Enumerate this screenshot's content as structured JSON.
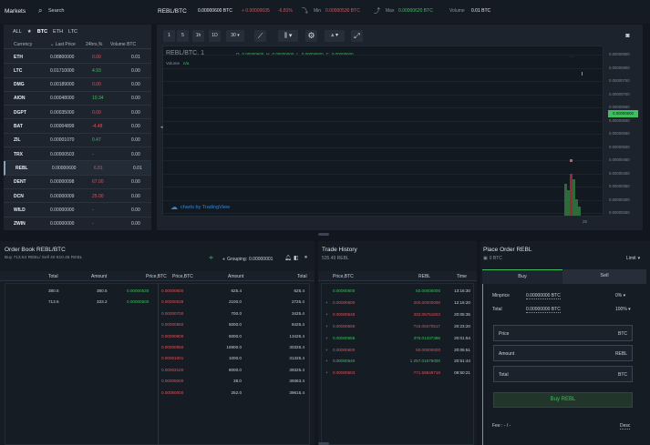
{
  "topbar": {
    "markets_label": "Markets",
    "search_label": "Search",
    "pair": "REBL/BTC",
    "last_price": "0.00000600 BTC",
    "change_abs": "+ 0.00000035",
    "change_pct": "-6.81%",
    "min_label": "Min",
    "min_value": "0.00000530 BTC",
    "max_label": "Max",
    "max_value": "0.00000620 BTC",
    "volume_label": "Volume",
    "volume_value": "0.01 BTC"
  },
  "markets": {
    "tabs": [
      "ALL",
      "★",
      "BTC",
      "ETH",
      "LTC"
    ],
    "active_tab": "BTC",
    "columns": [
      "Currency",
      "⌄ Last Price",
      "24hrs,%",
      "Volume BTC"
    ],
    "rows": [
      {
        "currency": "ETH",
        "price": "0.08800000",
        "change": "0.00",
        "dir": "red",
        "volume": "0.01"
      },
      {
        "currency": "LTC",
        "price": "0.01710000",
        "change": "4.93",
        "dir": "green",
        "volume": "0.00"
      },
      {
        "currency": "DMG",
        "price": "0.00189000",
        "change": "0.00",
        "dir": "red",
        "volume": "0.00"
      },
      {
        "currency": "AION",
        "price": "0.00048000",
        "change": "10.34",
        "dir": "green",
        "volume": "0.00"
      },
      {
        "currency": "DGPT",
        "price": "0.00035000",
        "change": "0.00",
        "dir": "red",
        "volume": "0.00"
      },
      {
        "currency": "BAT",
        "price": "0.00004899",
        "change": "-4.48",
        "dir": "red",
        "volume": "0.00"
      },
      {
        "currency": "ZIL",
        "price": "0.00001070",
        "change": "0.47",
        "dir": "green",
        "volume": "0.00"
      },
      {
        "currency": "TRX",
        "price": "0.00000503",
        "change": "-",
        "dir": "muted",
        "volume": "0.00"
      },
      {
        "currency": "REBL",
        "price": "0.00000600",
        "change": "6.81",
        "dir": "red",
        "volume": "0.01"
      },
      {
        "currency": "DENT",
        "price": "0.00000098",
        "change": "67.00",
        "dir": "red",
        "volume": "0.00"
      },
      {
        "currency": "DCN",
        "price": "0.00000009",
        "change": "25.00",
        "dir": "red",
        "volume": "0.00"
      },
      {
        "currency": "WILD",
        "price": "0.00000000",
        "change": "-",
        "dir": "muted",
        "volume": "0.00"
      },
      {
        "currency": "ZWIN",
        "price": "0.00000000",
        "change": "-",
        "dir": "muted",
        "volume": "0.00"
      }
    ]
  },
  "chart": {
    "intervals": [
      "1",
      "5",
      "1h",
      "1D",
      "30"
    ],
    "legend_symbol": "REBL/BTC, 1",
    "legend_o": "O",
    "legend_o_val": "0.00000600",
    "legend_h": "H",
    "legend_h_val": "0.00000600",
    "legend_l": "L",
    "legend_l_val": "0.00000600",
    "legend_c": "C",
    "legend_c_val": "0.00000600",
    "volume_label": "Volume",
    "volume_val": "n/a",
    "price_ticks": [
      "0.00000900",
      "0.00000800",
      "0.00000750",
      "0.00000700",
      "0.00000650",
      "0.00000600",
      "0.00000550",
      "0.00000500",
      "0.00000450",
      "0.00000400",
      "0.00000350",
      "0.00000300",
      "0.00000250"
    ],
    "current_price_tag": "0.00000600",
    "x_tick": "25",
    "watermark": "charts by TradingView",
    "colors": {
      "up": "#3fbf5f",
      "down": "#e0525a",
      "accent": "#3fbf5f"
    }
  },
  "orderbook": {
    "title": "Order Book REBL/BTC",
    "subtitle": "Buy 713.64 REBL/ Sell 40 610.45 REBL",
    "grouping_label": "Grouping:",
    "grouping_value": "0.00000001",
    "buy_columns": [
      "Total",
      "Amount",
      "Price,BTC"
    ],
    "sell_columns": [
      "Price,BTC",
      "Amount",
      "Total"
    ],
    "buys": [
      {
        "total": "380.5",
        "amount": "380.5",
        "price": "0.00000530"
      },
      {
        "total": "713.6",
        "amount": "333.2",
        "price": "0.00000500"
      }
    ],
    "sells": [
      {
        "price": "0.00000600",
        "amount": "625.4",
        "total": "625.4"
      },
      {
        "price": "0.00000639",
        "amount": "2100.0",
        "total": "2725.4"
      },
      {
        "price": "0.00000700",
        "amount": "700.0",
        "total": "3425.4"
      },
      {
        "price": "0.00000850",
        "amount": "5000.0",
        "total": "8425.4"
      },
      {
        "price": "0.00000900",
        "amount": "5000.0",
        "total": "13425.4"
      },
      {
        "price": "0.00000950",
        "amount": "16900.0",
        "total": "30325.4"
      },
      {
        "price": "0.00001001",
        "amount": "1000.0",
        "total": "31325.4"
      },
      {
        "price": "0.00003100",
        "amount": "8000.0",
        "total": "39325.4"
      },
      {
        "price": "0.00005000",
        "amount": "38.0",
        "total": "39363.4"
      },
      {
        "price": "0.00050000",
        "amount": "252.0",
        "total": "39615.4"
      }
    ]
  },
  "trades": {
    "title": "Trade History",
    "subtitle": "535.49 REBL",
    "columns": [
      "Price,BTC",
      "REBL",
      "Time"
    ],
    "rows": [
      {
        "price": "0.00000600",
        "amount": "50.00000000",
        "time": "13:16:30",
        "dir": "green",
        "sign": ""
      },
      {
        "price": "0.00000600",
        "amount": "200.00000000",
        "time": "12:16:20",
        "dir": "red",
        "sign": "+"
      },
      {
        "price": "0.00000548",
        "amount": "332.05751823",
        "time": "20:05:35",
        "dir": "red",
        "sign": "+"
      },
      {
        "price": "0.00000559",
        "amount": "716.09370517",
        "time": "20:23:20",
        "dir": "red",
        "sign": "+"
      },
      {
        "price": "0.00000558",
        "amount": "375.01337396",
        "time": "20:01:54",
        "dir": "green",
        "sign": "+"
      },
      {
        "price": "0.00000600",
        "amount": "50.00000000",
        "time": "20:05:51",
        "dir": "red",
        "sign": "+"
      },
      {
        "price": "0.00000540",
        "amount": "1 257.01675000",
        "time": "20:51:44",
        "dir": "green",
        "sign": "+"
      },
      {
        "price": "0.00000503",
        "amount": "771.58849718",
        "time": "08:50:21",
        "dir": "red",
        "sign": "+"
      }
    ]
  },
  "place_order": {
    "title": "Place Order REBL",
    "balance": "0 BTC",
    "order_type": "Limit",
    "tab_buy": "Buy",
    "tab_sell": "Sell",
    "minprice_label": "Minprice",
    "minprice_value": "0.00000000 BTC",
    "minprice_pct": "0%",
    "total_label": "Total",
    "total_value": "0.00000000 BTC",
    "total_pct": "100%",
    "price_label": "Price",
    "price_unit": "BTC",
    "amount_label": "Amount",
    "amount_unit": "REBL",
    "total2_label": "Total",
    "total2_unit": "BTC",
    "buy_button": "Buy REBL",
    "fee_label": "Fee : - / -",
    "desc_label": "Desc"
  }
}
